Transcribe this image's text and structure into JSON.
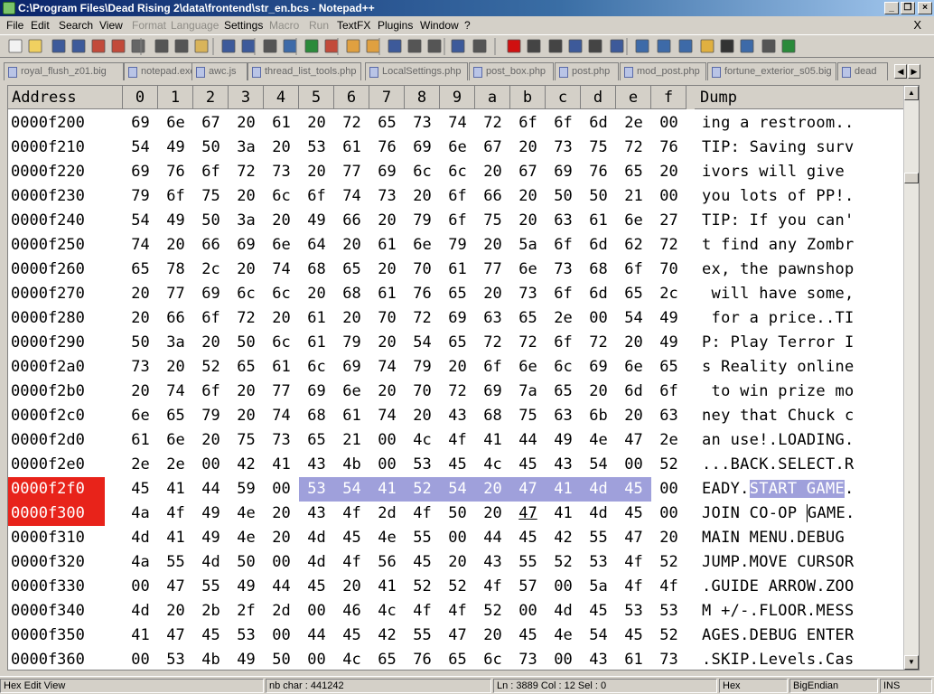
{
  "window": {
    "title": "C:\\Program Files\\Dead Rising 2\\data\\frontend\\str_en.bcs - Notepad++",
    "minimize": "_",
    "restore": "❐",
    "close": "×"
  },
  "menu": {
    "items": [
      {
        "label": "File",
        "disabled": false
      },
      {
        "label": "Edit",
        "disabled": false
      },
      {
        "label": "Search",
        "disabled": false
      },
      {
        "label": "View",
        "disabled": false
      },
      {
        "label": "Format",
        "disabled": true
      },
      {
        "label": "Language",
        "disabled": true
      },
      {
        "label": "Settings",
        "disabled": false
      },
      {
        "label": "Macro",
        "disabled": true
      },
      {
        "label": "Run",
        "disabled": true
      },
      {
        "label": "TextFX",
        "disabled": false
      },
      {
        "label": "Plugins",
        "disabled": false
      },
      {
        "label": "Window",
        "disabled": false
      },
      {
        "label": "?",
        "disabled": false
      }
    ],
    "close_doc": "X"
  },
  "toolbar": {
    "icons": [
      "new-file-icon",
      "open-file-icon",
      "save-icon",
      "save-all-icon",
      "close-icon",
      "close-all-icon",
      "print-icon",
      "cut-icon",
      "copy-icon",
      "paste-icon",
      "undo-icon",
      "redo-icon",
      "find-icon",
      "replace-icon",
      "zoom-in-icon",
      "zoom-out-icon",
      "sync-v-icon",
      "sync-h-icon",
      "wrap-icon",
      "all-chars-icon",
      "indent-guide-icon",
      "udl-icon",
      "doc-map-icon",
      "record-macro-icon",
      "stop-macro-icon",
      "play-macro-icon",
      "run-macro-icon",
      "save-macro-icon",
      "compare-icon",
      "up-icon",
      "first-icon",
      "down-icon",
      "folder-icon",
      "hex-icon",
      "view-icon",
      "print-preview-icon",
      "spell-icon"
    ]
  },
  "tabs": [
    {
      "label": "royal_flush_z01.big"
    },
    {
      "label": "notepad.exe"
    },
    {
      "label": "awc.js"
    },
    {
      "label": "thread_list_tools.php"
    },
    {
      "label": "LocalSettings.php"
    },
    {
      "label": "post_box.php"
    },
    {
      "label": "post.php"
    },
    {
      "label": "mod_post.php"
    },
    {
      "label": "fortune_exterior_s05.big"
    },
    {
      "label": "dead"
    }
  ],
  "hex": {
    "header": {
      "address": "Address",
      "columns": [
        "0",
        "1",
        "2",
        "3",
        "4",
        "5",
        "6",
        "7",
        "8",
        "9",
        "a",
        "b",
        "c",
        "d",
        "e",
        "f"
      ],
      "dump": "Dump"
    },
    "rows": [
      {
        "addr": "0000f200",
        "bytes": [
          "69",
          "6e",
          "67",
          "20",
          "61",
          "20",
          "72",
          "65",
          "73",
          "74",
          "72",
          "6f",
          "6f",
          "6d",
          "2e",
          "00"
        ],
        "dump": "ing a restroom.."
      },
      {
        "addr": "0000f210",
        "bytes": [
          "54",
          "49",
          "50",
          "3a",
          "20",
          "53",
          "61",
          "76",
          "69",
          "6e",
          "67",
          "20",
          "73",
          "75",
          "72",
          "76"
        ],
        "dump": "TIP: Saving surv"
      },
      {
        "addr": "0000f220",
        "bytes": [
          "69",
          "76",
          "6f",
          "72",
          "73",
          "20",
          "77",
          "69",
          "6c",
          "6c",
          "20",
          "67",
          "69",
          "76",
          "65",
          "20"
        ],
        "dump": "ivors will give "
      },
      {
        "addr": "0000f230",
        "bytes": [
          "79",
          "6f",
          "75",
          "20",
          "6c",
          "6f",
          "74",
          "73",
          "20",
          "6f",
          "66",
          "20",
          "50",
          "50",
          "21",
          "00"
        ],
        "dump": "you lots of PP!."
      },
      {
        "addr": "0000f240",
        "bytes": [
          "54",
          "49",
          "50",
          "3a",
          "20",
          "49",
          "66",
          "20",
          "79",
          "6f",
          "75",
          "20",
          "63",
          "61",
          "6e",
          "27"
        ],
        "dump": "TIP: If you can'"
      },
      {
        "addr": "0000f250",
        "bytes": [
          "74",
          "20",
          "66",
          "69",
          "6e",
          "64",
          "20",
          "61",
          "6e",
          "79",
          "20",
          "5a",
          "6f",
          "6d",
          "62",
          "72"
        ],
        "dump": "t find any Zombr"
      },
      {
        "addr": "0000f260",
        "bytes": [
          "65",
          "78",
          "2c",
          "20",
          "74",
          "68",
          "65",
          "20",
          "70",
          "61",
          "77",
          "6e",
          "73",
          "68",
          "6f",
          "70"
        ],
        "dump": "ex, the pawnshop"
      },
      {
        "addr": "0000f270",
        "bytes": [
          "20",
          "77",
          "69",
          "6c",
          "6c",
          "20",
          "68",
          "61",
          "76",
          "65",
          "20",
          "73",
          "6f",
          "6d",
          "65",
          "2c"
        ],
        "dump": " will have some,"
      },
      {
        "addr": "0000f280",
        "bytes": [
          "20",
          "66",
          "6f",
          "72",
          "20",
          "61",
          "20",
          "70",
          "72",
          "69",
          "63",
          "65",
          "2e",
          "00",
          "54",
          "49"
        ],
        "dump": " for a price..TI"
      },
      {
        "addr": "0000f290",
        "bytes": [
          "50",
          "3a",
          "20",
          "50",
          "6c",
          "61",
          "79",
          "20",
          "54",
          "65",
          "72",
          "72",
          "6f",
          "72",
          "20",
          "49"
        ],
        "dump": "P: Play Terror I"
      },
      {
        "addr": "0000f2a0",
        "bytes": [
          "73",
          "20",
          "52",
          "65",
          "61",
          "6c",
          "69",
          "74",
          "79",
          "20",
          "6f",
          "6e",
          "6c",
          "69",
          "6e",
          "65"
        ],
        "dump": "s Reality online"
      },
      {
        "addr": "0000f2b0",
        "bytes": [
          "20",
          "74",
          "6f",
          "20",
          "77",
          "69",
          "6e",
          "20",
          "70",
          "72",
          "69",
          "7a",
          "65",
          "20",
          "6d",
          "6f"
        ],
        "dump": " to win prize mo"
      },
      {
        "addr": "0000f2c0",
        "bytes": [
          "6e",
          "65",
          "79",
          "20",
          "74",
          "68",
          "61",
          "74",
          "20",
          "43",
          "68",
          "75",
          "63",
          "6b",
          "20",
          "63"
        ],
        "dump": "ney that Chuck c"
      },
      {
        "addr": "0000f2d0",
        "bytes": [
          "61",
          "6e",
          "20",
          "75",
          "73",
          "65",
          "21",
          "00",
          "4c",
          "4f",
          "41",
          "44",
          "49",
          "4e",
          "47",
          "2e"
        ],
        "dump": "an use!.LOADING."
      },
      {
        "addr": "0000f2e0",
        "bytes": [
          "2e",
          "2e",
          "00",
          "42",
          "41",
          "43",
          "4b",
          "00",
          "53",
          "45",
          "4c",
          "45",
          "43",
          "54",
          "00",
          "52"
        ],
        "dump": "...BACK.SELECT.R"
      },
      {
        "addr": "0000f2f0",
        "bytes": [
          "45",
          "41",
          "44",
          "59",
          "00",
          "53",
          "54",
          "41",
          "52",
          "54",
          "20",
          "47",
          "41",
          "4d",
          "45",
          "00"
        ],
        "dump": "EADY.START GAME.",
        "selected": true,
        "hl_from": 5,
        "hl_to": 14
      },
      {
        "addr": "0000f300",
        "bytes": [
          "4a",
          "4f",
          "49",
          "4e",
          "20",
          "43",
          "4f",
          "2d",
          "4f",
          "50",
          "20",
          "47",
          "41",
          "4d",
          "45",
          "00"
        ],
        "dump": "JOIN CO-OP GAME.",
        "selected": true,
        "cursor_byte": 11
      },
      {
        "addr": "0000f310",
        "bytes": [
          "4d",
          "41",
          "49",
          "4e",
          "20",
          "4d",
          "45",
          "4e",
          "55",
          "00",
          "44",
          "45",
          "42",
          "55",
          "47",
          "20"
        ],
        "dump": "MAIN MENU.DEBUG "
      },
      {
        "addr": "0000f320",
        "bytes": [
          "4a",
          "55",
          "4d",
          "50",
          "00",
          "4d",
          "4f",
          "56",
          "45",
          "20",
          "43",
          "55",
          "52",
          "53",
          "4f",
          "52"
        ],
        "dump": "JUMP.MOVE CURSOR"
      },
      {
        "addr": "0000f330",
        "bytes": [
          "00",
          "47",
          "55",
          "49",
          "44",
          "45",
          "20",
          "41",
          "52",
          "52",
          "4f",
          "57",
          "00",
          "5a",
          "4f",
          "4f"
        ],
        "dump": ".GUIDE ARROW.ZOO"
      },
      {
        "addr": "0000f340",
        "bytes": [
          "4d",
          "20",
          "2b",
          "2f",
          "2d",
          "00",
          "46",
          "4c",
          "4f",
          "4f",
          "52",
          "00",
          "4d",
          "45",
          "53",
          "53"
        ],
        "dump": "M +/-.FLOOR.MESS"
      },
      {
        "addr": "0000f350",
        "bytes": [
          "41",
          "47",
          "45",
          "53",
          "00",
          "44",
          "45",
          "42",
          "55",
          "47",
          "20",
          "45",
          "4e",
          "54",
          "45",
          "52"
        ],
        "dump": "AGES.DEBUG ENTER"
      },
      {
        "addr": "0000f360",
        "bytes": [
          "00",
          "53",
          "4b",
          "49",
          "50",
          "00",
          "4c",
          "65",
          "76",
          "65",
          "6c",
          "73",
          "00",
          "43",
          "61",
          "73"
        ],
        "dump": ".SKIP.Levels.Cas"
      }
    ]
  },
  "status": {
    "mode": "Hex Edit View",
    "nb_char": "nb char : 441242",
    "position": "Ln : 3889   Col : 12   Sel : 0",
    "encoding": "Hex",
    "endian": "BigEndian",
    "ins": "INS"
  }
}
